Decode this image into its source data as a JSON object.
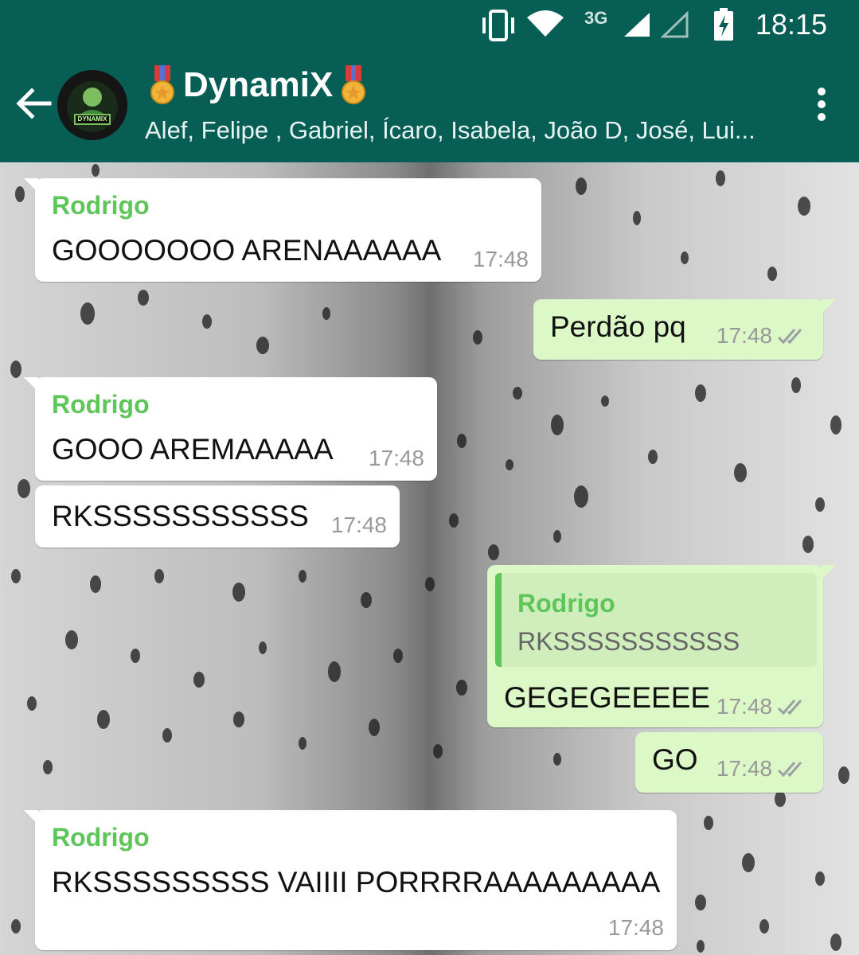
{
  "status_bar": {
    "time": "18:15",
    "network": "3G"
  },
  "header": {
    "title": "DynamiX",
    "participants": "Alef, Felipe , Gabriel, Ícaro, Isabela, João D, José, Lui...",
    "avatar_text": "DYNAMIX"
  },
  "messages": [
    {
      "sender": "Rodrigo",
      "text": "GOOOOOOO ARENAAAAAA",
      "time": "17:48"
    },
    {
      "text": "Perdão pq",
      "time": "17:48"
    },
    {
      "sender": "Rodrigo",
      "text": "GOOO AREMAAAAA",
      "time": "17:48"
    },
    {
      "text": "RKSSSSSSSSSSS",
      "time": "17:48"
    },
    {
      "quoted_sender": "Rodrigo",
      "quoted_text": "RKSSSSSSSSSSS",
      "text": "GEGEGEEEEE",
      "time": "17:48"
    },
    {
      "text": "GO",
      "time": "17:48"
    },
    {
      "sender": "Rodrigo",
      "text": "RKSSSSSSSSS VAIIII PORRRRAAAAAAAAA",
      "time": "17:48"
    }
  ],
  "colors": {
    "app_bar": "#075e54",
    "incoming_bubble": "#ffffff",
    "outgoing_bubble": "#dcf8c6",
    "sender_name": "#5fc45a",
    "read_ticks": "#9aa0a6"
  }
}
